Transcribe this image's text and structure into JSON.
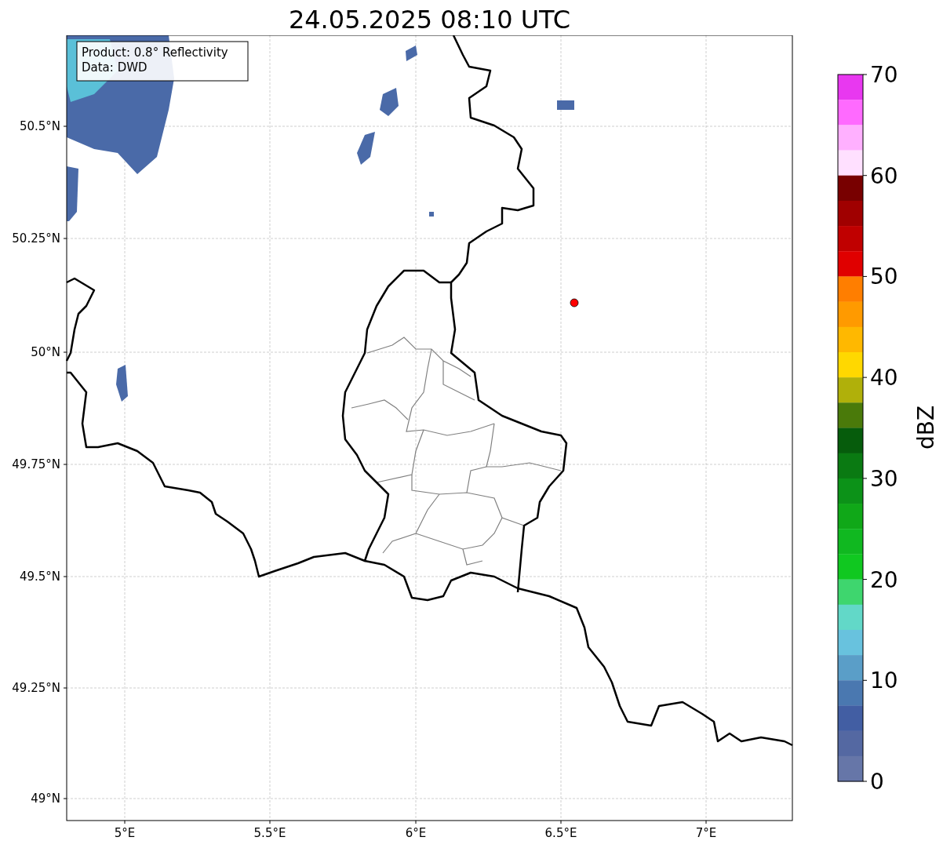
{
  "title": "24.05.2025 08:10 UTC",
  "info_box": [
    "Product: 0.8° Reflectivity",
    "Data: DWD"
  ],
  "y_ticks": [
    "50.5°N",
    "50.25°N",
    "50°N",
    "49.75°N",
    "49.5°N",
    "49.25°N",
    "49°N"
  ],
  "x_ticks": [
    "5°E",
    "5.5°E",
    "6°E",
    "6.5°E",
    "7°E"
  ],
  "colorbar": {
    "label": "dBZ",
    "ticks": [
      "70",
      "60",
      "50",
      "40",
      "30",
      "20",
      "10",
      "0"
    ],
    "bands": [
      {
        "color": "#e838f0"
      },
      {
        "color": "#ff6aff"
      },
      {
        "color": "#ffb0ff"
      },
      {
        "color": "#ffe0ff"
      },
      {
        "color": "#780000"
      },
      {
        "color": "#a00000"
      },
      {
        "color": "#c00000"
      },
      {
        "color": "#e00000"
      },
      {
        "color": "#ff7e00"
      },
      {
        "color": "#ff9a00"
      },
      {
        "color": "#ffb800"
      },
      {
        "color": "#ffd800"
      },
      {
        "color": "#b0b00a"
      },
      {
        "color": "#4a7a0a"
      },
      {
        "color": "#065c0c"
      },
      {
        "color": "#0a7a12"
      },
      {
        "color": "#0c9218"
      },
      {
        "color": "#10a818"
      },
      {
        "color": "#10b820"
      },
      {
        "color": "#10c820"
      },
      {
        "color": "#3ed66e"
      },
      {
        "color": "#62d8c8"
      },
      {
        "color": "#68c2de"
      },
      {
        "color": "#5a9ec8"
      },
      {
        "color": "#4a78b0"
      },
      {
        "color": "#425ea3"
      },
      {
        "color": "#5468a2"
      },
      {
        "color": "#6676a8"
      }
    ]
  }
}
